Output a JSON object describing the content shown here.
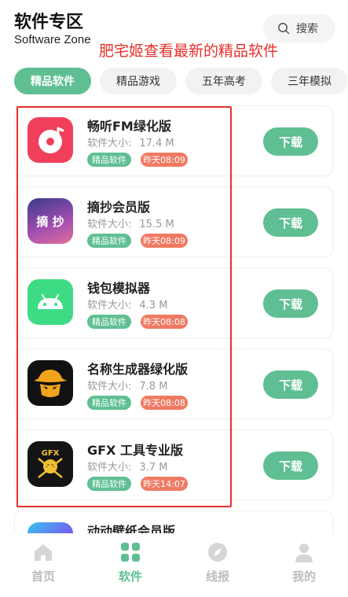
{
  "header": {
    "title": "软件专区",
    "subtitle": "Software Zone",
    "search_label": "搜索",
    "annotation": "肥宅姬查看最新的精品软件"
  },
  "tabs": [
    {
      "label": "精品软件",
      "active": true
    },
    {
      "label": "精品游戏",
      "active": false
    },
    {
      "label": "五年高考",
      "active": false
    },
    {
      "label": "三年模拟",
      "active": false
    }
  ],
  "apps": [
    {
      "name": "畅听FM绿化版",
      "size_label": "软件大小:",
      "size": "17.4 M",
      "category": "精品软件",
      "time": "昨天08:09",
      "download": "下载",
      "icon": "music-disc-icon"
    },
    {
      "name": "摘抄会员版",
      "size_label": "软件大小:",
      "size": "15.5 M",
      "category": "精品软件",
      "time": "昨天08:09",
      "download": "下载",
      "icon": "zhai-chao-icon",
      "icon_text": "摘 抄"
    },
    {
      "name": "钱包模拟器",
      "size_label": "软件大小:",
      "size": "4.3 M",
      "category": "精品软件",
      "time": "昨天08:08",
      "download": "下载",
      "icon": "android-icon"
    },
    {
      "name": "名称生成器绿化版",
      "size_label": "软件大小:",
      "size": "7.8 M",
      "category": "精品软件",
      "time": "昨天08:08",
      "download": "下载",
      "icon": "cowboy-hat-icon"
    },
    {
      "name": "GFX 工具专业版",
      "size_label": "软件大小:",
      "size": "3.7 M",
      "category": "精品软件",
      "time": "昨天14:07",
      "download": "下载",
      "icon": "gfx-skull-icon",
      "icon_text": "GFX"
    },
    {
      "name": "动动壁纸会员版",
      "icon": "wallpaper-icon"
    }
  ],
  "nav": [
    {
      "label": "首页",
      "icon": "home-icon",
      "active": false
    },
    {
      "label": "软件",
      "icon": "apps-grid-icon",
      "active": true
    },
    {
      "label": "线报",
      "icon": "compass-icon",
      "active": false
    },
    {
      "label": "我的",
      "icon": "user-icon",
      "active": false
    }
  ],
  "colors": {
    "accent": "#5fbf93",
    "time_badge": "#ef7a62",
    "annotation": "#e8302a"
  }
}
